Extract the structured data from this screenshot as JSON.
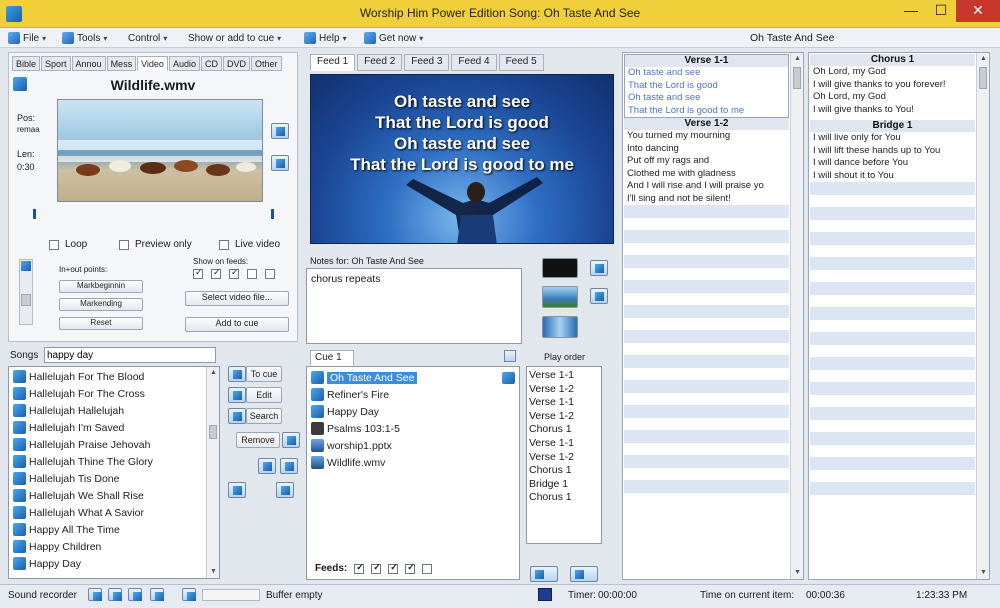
{
  "window": {
    "title": "Worship Him Power Edition Song: Oh Taste And See",
    "close_glyph": "✕",
    "min_glyph": "—",
    "max_glyph": "☐"
  },
  "menu": {
    "items": [
      "File",
      "Tools",
      "Control",
      "Show or add to cue",
      "Help",
      "Get now"
    ],
    "current_song": "Oh Taste And See"
  },
  "media_tabs": [
    "Bible",
    "Sport",
    "Annou",
    "Mess",
    "Video",
    "Audio",
    "CD",
    "DVD",
    "Other"
  ],
  "video": {
    "filename": "Wildlife.wmv",
    "pos_label": "Pos:",
    "pos_value": "remaa",
    "len_label": "Len:",
    "len_value": "0:30",
    "loop_label": "Loop",
    "preview_label": "Preview only",
    "live_label": "Live video",
    "inout_label": "In+out points:",
    "mark_begin": "Markbeginnin",
    "mark_end": "Markending",
    "reset": "Reset",
    "show_on_feeds": "Show on feeds:",
    "select_video": "Select video file...",
    "add_to_cue": "Add to cue"
  },
  "songs": {
    "label": "Songs",
    "search_value": "happy day",
    "items": [
      "Hallelujah For The Blood",
      "Hallelujah For The Cross",
      "Hallelujah Hallelujah",
      "Hallelujah I'm Saved",
      "Hallelujah Praise Jehovah",
      "Hallelujah Thine The Glory",
      "Hallelujah Tis Done",
      "Hallelujah We Shall Rise",
      "Hallelujah What A Savior",
      "Happy All The Time",
      "Happy Children",
      "Happy Day"
    ]
  },
  "song_buttons": {
    "to_cue": "To cue",
    "edit": "Edit",
    "search": "Search",
    "remove": "Remove"
  },
  "feeds": {
    "tabs": [
      "Feed 1",
      "Feed 2",
      "Feed 3",
      "Feed 4",
      "Feed 5"
    ],
    "preview_lines": [
      "Oh taste and see",
      "That the Lord is good",
      "Oh taste and see",
      "That the Lord is good to me"
    ]
  },
  "notes": {
    "label": "Notes for: Oh Taste And See",
    "value": "chorus repeats"
  },
  "cue": {
    "tab": "Cue 1",
    "items": [
      {
        "label": "Oh Taste And See",
        "icon": "song-icon"
      },
      {
        "label": "Refiner's Fire",
        "icon": "song-icon"
      },
      {
        "label": "Happy Day",
        "icon": "song-icon"
      },
      {
        "label": "Psalms 103:1-5",
        "icon": "bible-icon"
      },
      {
        "label": "worship1.pptx",
        "icon": "ppt-icon"
      },
      {
        "label": "Wildlife.wmv",
        "icon": "video-icon"
      }
    ],
    "feeds_label": "Feeds:"
  },
  "play_order": {
    "label": "Play order",
    "items": [
      "Verse 1-1",
      "Verse 1-2",
      "Verse 1-1",
      "Verse 1-2",
      "Chorus 1",
      "Verse 1-1",
      "Verse 1-2",
      "Chorus 1",
      "Bridge 1",
      "Chorus 1"
    ]
  },
  "lyrics_left": {
    "verse1_title": "Verse 1-1",
    "verse1_lines": [
      "Oh taste and see",
      "That the Lord is good",
      "Oh taste and see",
      "That the Lord is good to me"
    ],
    "verse2_title": "Verse 1-2",
    "verse2_lines": [
      "You turned my mourning",
      "Into dancing",
      "Put off my rags and",
      "Clothed me with gladness",
      "And I will rise and I will praise yo",
      "I'll sing and not be silent!"
    ]
  },
  "lyrics_right": {
    "chorus_title": "Chorus 1",
    "chorus_lines": [
      "Oh Lord, my God",
      "I will give thanks to you forever!",
      "Oh Lord, my God",
      "I will give thanks to You!"
    ],
    "bridge_title": "Bridge 1",
    "bridge_lines": [
      "I will live only for You",
      "I will lift these hands up to You",
      "I will dance before You",
      "I will shout it to You"
    ]
  },
  "status": {
    "sound_recorder": "Sound recorder",
    "buffer": "Buffer empty",
    "timer_label": "Timer:",
    "timer_value": "00:00:00",
    "time_on_item_label": "Time on current item:",
    "time_on_item_value": "00:00:36",
    "clock": "1:23:33 PM"
  },
  "colors": {
    "titlebar": "#f0cf3a",
    "close": "#c8372c",
    "selection": "#3b8de0",
    "preview_bg": "#1d4fa0"
  }
}
